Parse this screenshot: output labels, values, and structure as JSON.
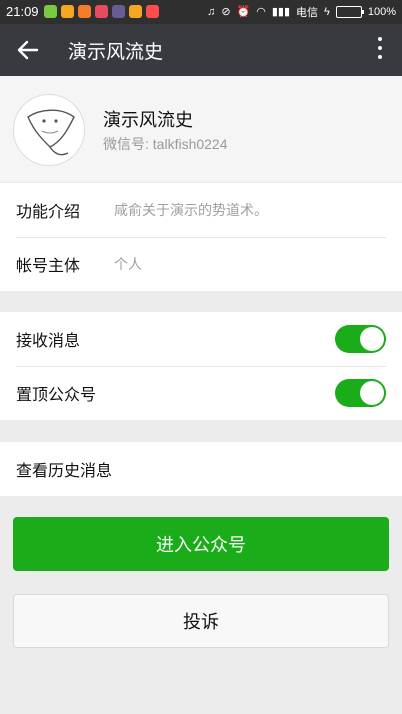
{
  "status_bar": {
    "time": "21:09",
    "carrier": "电信",
    "battery": "100%",
    "battery_level": 1.0,
    "app_icon_colors": [
      "#f5a623",
      "#ff6b3d",
      "#f46c2d",
      "#e84a5f",
      "#6b5b95",
      "#f5a623",
      "#ff4d4d"
    ]
  },
  "header": {
    "title": "演示风流史"
  },
  "profile": {
    "name": "演示风流史",
    "wechat_id": "微信号: talkfish0224"
  },
  "info": {
    "intro_label": "功能介绍",
    "intro_value": "咸俞关于演示的势道术。",
    "owner_label": "帐号主体",
    "owner_value": "个人"
  },
  "settings": {
    "receive_label": "接收消息",
    "receive_on": true,
    "pin_label": "置顶公众号",
    "pin_on": true
  },
  "history": {
    "label": "查看历史消息"
  },
  "actions": {
    "enter_label": "进入公众号",
    "report_label": "投诉"
  },
  "colors": {
    "accent": "#1aad19",
    "titlebar": "#393a3f"
  }
}
